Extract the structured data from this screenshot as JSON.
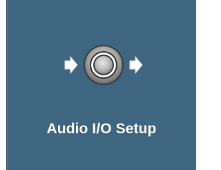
{
  "tile": {
    "label": "Audio I/O Setup",
    "icon": "audio-io-connector-icon",
    "background_color": "#3f6680",
    "label_color": "#ffffff"
  }
}
